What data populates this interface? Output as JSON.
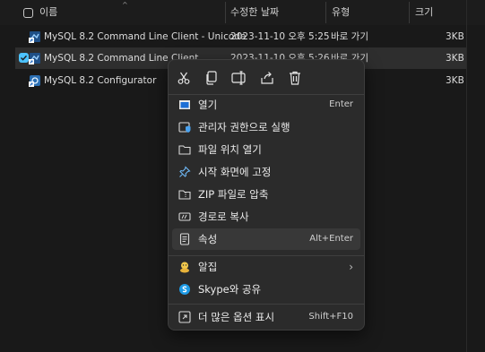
{
  "columns": {
    "name": "이름",
    "modified": "수정한 날짜",
    "type": "유형",
    "size": "크기"
  },
  "rows": [
    {
      "name": "MySQL 8.2 Command Line Client - Unicode",
      "modified": "2023-11-10 오후 5:25",
      "type": "바로 가기",
      "size": "3KB",
      "selected": false
    },
    {
      "name": "MySQL 8.2 Command Line Client",
      "modified": "2023-11-10 오후 5:26",
      "type": "바로 가기",
      "size": "3KB",
      "selected": true
    },
    {
      "name": "MySQL 8.2 Configurator",
      "modified": "",
      "type": "",
      "size": "3KB",
      "selected": false
    }
  ],
  "context_menu": {
    "quick_actions": [
      {
        "icon": "cut-icon",
        "label": "잘라내기"
      },
      {
        "icon": "copy-icon",
        "label": "복사"
      },
      {
        "icon": "rename-icon",
        "label": "이름 바꾸기"
      },
      {
        "icon": "share-icon",
        "label": "공유"
      },
      {
        "icon": "delete-icon",
        "label": "삭제"
      }
    ],
    "items": [
      {
        "icon": "open-icon",
        "label": "열기",
        "shortcut": "Enter"
      },
      {
        "icon": "run-as-admin-icon",
        "label": "관리자 권한으로 실행",
        "shortcut": ""
      },
      {
        "icon": "folder-icon",
        "label": "파일 위치 열기",
        "shortcut": ""
      },
      {
        "icon": "pin-icon",
        "label": "시작 화면에 고정",
        "shortcut": ""
      },
      {
        "icon": "zip-icon",
        "label": "ZIP 파일로 압축",
        "shortcut": ""
      },
      {
        "icon": "copy-path-icon",
        "label": "경로로 복사",
        "shortcut": ""
      },
      {
        "icon": "properties-icon",
        "label": "속성",
        "shortcut": "Alt+Enter"
      },
      {
        "icon": "alzip-icon",
        "label": "알집",
        "shortcut": ""
      },
      {
        "icon": "skype-icon",
        "label": "Skype와 공유",
        "shortcut": ""
      },
      {
        "icon": "more-options-icon",
        "label": "더 많은 옵션 표시",
        "shortcut": "Shift+F10"
      }
    ]
  },
  "colors": {
    "background": "#191919",
    "menu_background": "#2b2b2b",
    "accent": "#4cc2ff",
    "hover": "#383838"
  }
}
